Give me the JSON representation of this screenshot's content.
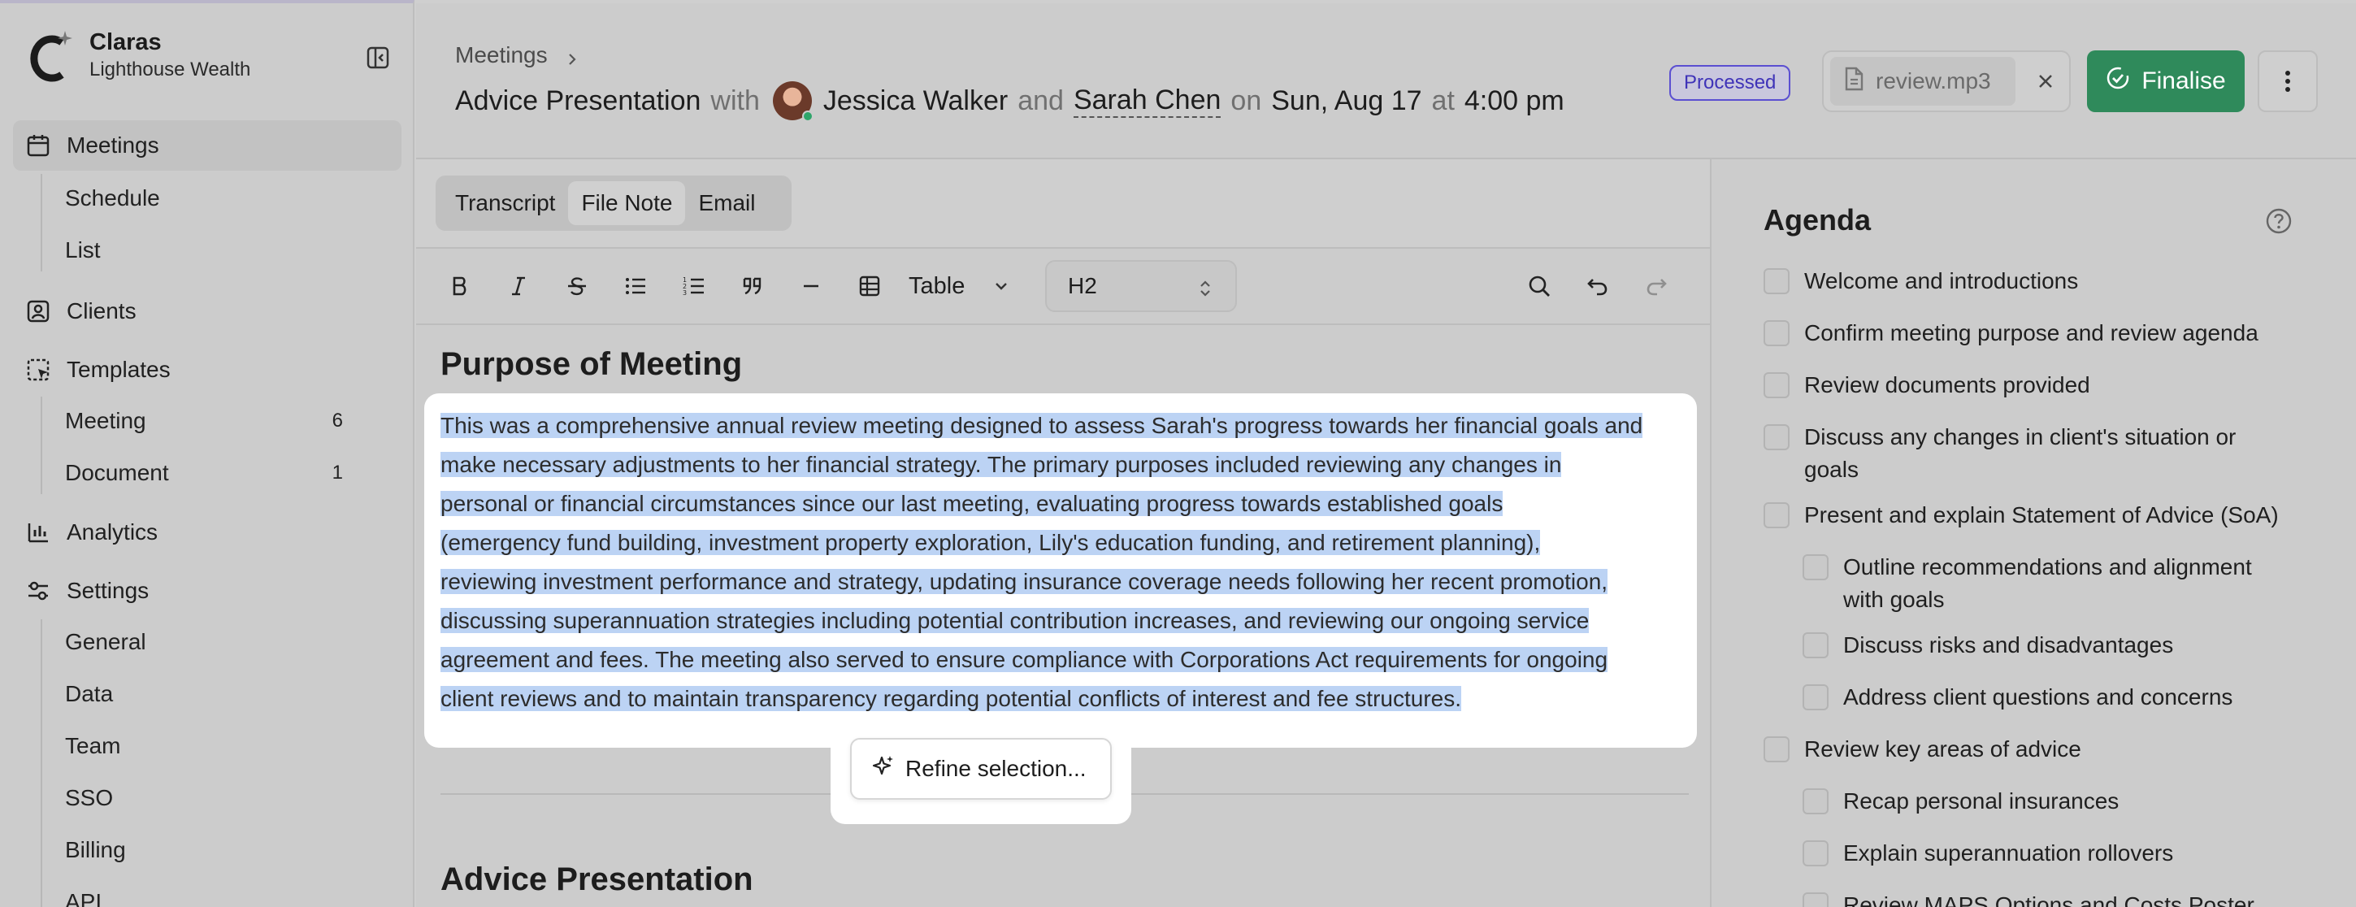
{
  "brand": {
    "name": "Claras",
    "org": "Lighthouse Wealth"
  },
  "sidebar": {
    "items": [
      {
        "label": "Meetings"
      },
      {
        "label": "Schedule"
      },
      {
        "label": "List"
      },
      {
        "label": "Clients"
      },
      {
        "label": "Templates"
      },
      {
        "label": "Meeting",
        "count": "6"
      },
      {
        "label": "Document",
        "count": "1"
      },
      {
        "label": "Analytics"
      },
      {
        "label": "Settings"
      },
      {
        "label": "General"
      },
      {
        "label": "Data"
      },
      {
        "label": "Team"
      },
      {
        "label": "SSO"
      },
      {
        "label": "Billing"
      },
      {
        "label": "API"
      }
    ]
  },
  "header": {
    "breadcrumb": "Meetings",
    "meeting_type": "Advice Presentation",
    "with_word": "with",
    "client1": "Jessica Walker",
    "and_word": "and",
    "client2": "Sarah Chen",
    "on_word": "on",
    "date": "Sun, Aug 17",
    "at_word": "at",
    "time": "4:00 pm",
    "status": "Processed",
    "file_name": "review.mp3",
    "finalise_label": "Finalise"
  },
  "tabs": [
    {
      "label": "Transcript"
    },
    {
      "label": "File Note"
    },
    {
      "label": "Email"
    }
  ],
  "toolbar": {
    "table_label": "Table",
    "heading_value": "H2"
  },
  "editor": {
    "heading1": "Purpose of Meeting",
    "paragraph_lines": [
      "This was a comprehensive annual review meeting designed to assess Sarah's progress towards her financial goals and",
      "make necessary adjustments to her financial strategy. The primary purposes included reviewing any changes in",
      "personal or financial circumstances since our last meeting, evaluating progress towards established goals",
      "(emergency fund building, investment property exploration, Lily's education funding, and retirement planning),",
      "reviewing investment performance and strategy, updating insurance coverage needs following her recent promotion,",
      "discussing superannuation strategies including potential contribution increases, and reviewing our ongoing service",
      "agreement and fees. The meeting also served to ensure compliance with Corporations Act requirements for ongoing",
      "client reviews and to maintain transparency regarding potential conflicts of interest and fee structures."
    ],
    "refine_label": "Refine selection...",
    "heading2": "Advice Presentation"
  },
  "agenda": {
    "title": "Agenda",
    "items": [
      {
        "label": "Welcome and introductions"
      },
      {
        "label": "Confirm meeting purpose and review agenda"
      },
      {
        "label": "Review documents provided"
      },
      {
        "label": "Discuss any changes in client's situation or goals"
      },
      {
        "label": "Present and explain Statement of Advice (SoA)"
      },
      {
        "label": "Outline recommendations and alignment with goals"
      },
      {
        "label": "Discuss risks and disadvantages"
      },
      {
        "label": "Address client questions and concerns"
      },
      {
        "label": "Review key areas of advice"
      },
      {
        "label": "Recap personal insurances"
      },
      {
        "label": "Explain superannuation rollovers"
      },
      {
        "label": "Review MAPS Options and Costs Poster"
      }
    ]
  },
  "colors": {
    "accent_green": "#2f8a5b",
    "processed_purple": "#5b4fd1",
    "selection_blue": "#bcd3f4"
  },
  "icons": [
    "logo-icon",
    "collapse-sidebar-icon",
    "calendar-icon",
    "client-icon",
    "template-icon",
    "analytics-icon",
    "settings-icon",
    "chevron-right-icon",
    "file-icon",
    "close-icon",
    "check-circle-icon",
    "more-vertical-icon",
    "bold-icon",
    "italic-icon",
    "strikethrough-icon",
    "bullet-list-icon",
    "numbered-list-icon",
    "quote-icon",
    "horizontal-rule-icon",
    "table-icon",
    "chevron-down-icon",
    "chevron-updown-icon",
    "search-icon",
    "undo-icon",
    "redo-icon",
    "sparkle-icon",
    "help-icon"
  ]
}
